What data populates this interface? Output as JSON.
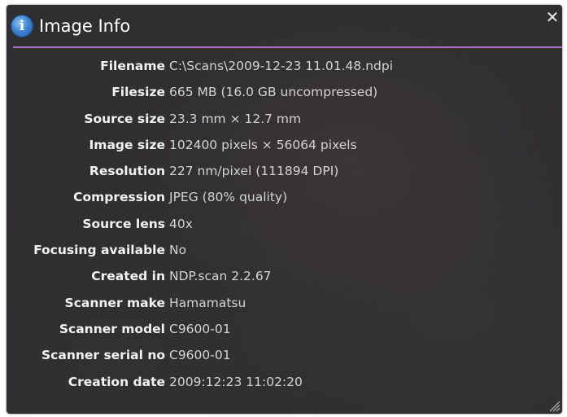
{
  "dialog": {
    "title": "Image Info",
    "close_label": "✕"
  },
  "properties": [
    {
      "label": "Filename",
      "value": "C:\\Scans\\2009-12-23 11.01.48.ndpi"
    },
    {
      "label": "Filesize",
      "value": "665 MB (16.0 GB uncompressed)"
    },
    {
      "label": "Source size",
      "value": "23.3 mm × 12.7 mm"
    },
    {
      "label": "Image size",
      "value": "102400 pixels × 56064 pixels"
    },
    {
      "label": "Resolution",
      "value": "227 nm/pixel (111894 DPI)"
    },
    {
      "label": "Compression",
      "value": "JPEG (80% quality)"
    },
    {
      "label": "Source lens",
      "value": "40x"
    },
    {
      "label": "Focusing available",
      "value": "No"
    },
    {
      "label": "Created in",
      "value": "NDP.scan 2.2.67"
    },
    {
      "label": "Scanner make",
      "value": "Hamamatsu"
    },
    {
      "label": "Scanner model",
      "value": "C9600-01"
    },
    {
      "label": "Scanner serial no",
      "value": "C9600-01"
    },
    {
      "label": "Creation date",
      "value": "2009:12:23 11:02:20"
    }
  ],
  "icons": {
    "title_icon": "info-icon",
    "close_icon": "close-icon",
    "grip_icon": "resize-grip-icon"
  },
  "colors": {
    "background": "#2f2e30",
    "divider": "#b070c8",
    "label": "#f2f2f2",
    "value": "#d4d4d4"
  }
}
